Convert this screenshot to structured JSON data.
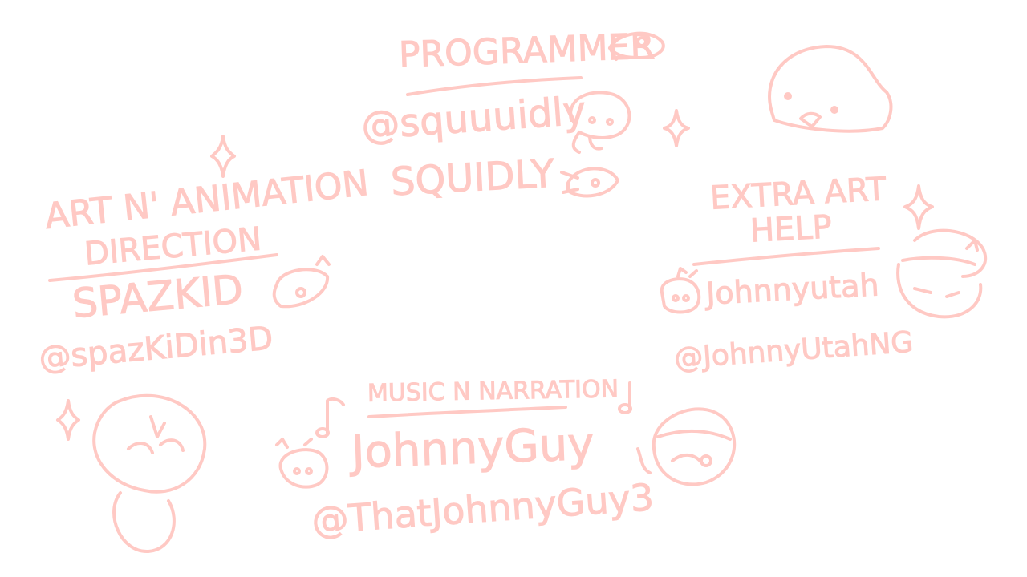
{
  "colors": {
    "ink": "#ffc9c4",
    "background": "#ffffff"
  },
  "programmer": {
    "role": "PROGRAMMER",
    "handle": "@squuuidly",
    "name": "SQUIDLY"
  },
  "art": {
    "role_line1": "ART N' ANIMATION",
    "role_line2": "DIRECTION",
    "name": "SPAZKID",
    "handle": "@spazKiDin3D"
  },
  "extra_art": {
    "role_line1": "EXTRA ART",
    "role_line2": "HELP",
    "name": "Johnnyutah",
    "handle": "@JohnnyUtahNG"
  },
  "music": {
    "role": "MUSIC N NARRATION",
    "name": "JohnnyGuy",
    "handle": "@ThatJohnnyGuy3"
  }
}
